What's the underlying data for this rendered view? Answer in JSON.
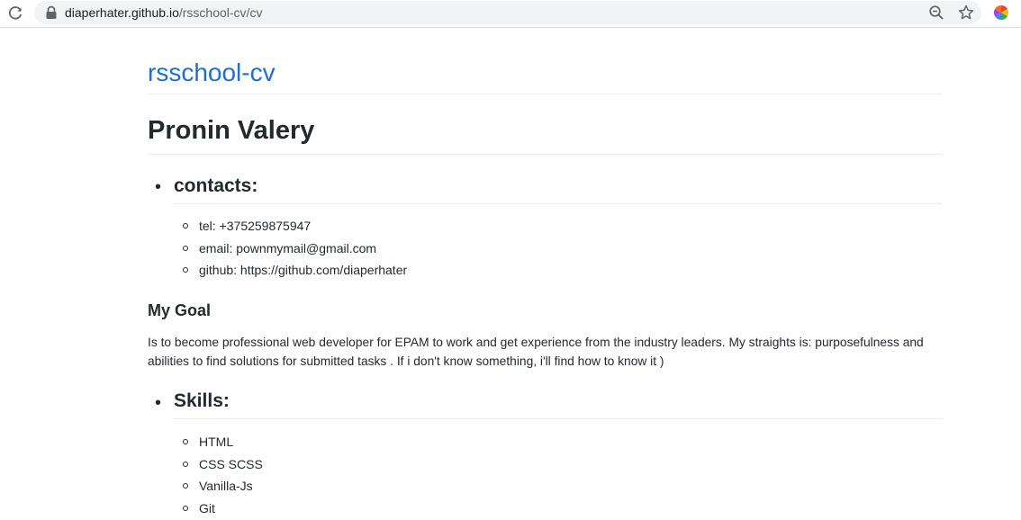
{
  "browser": {
    "url_host": "diaperhater.github.io",
    "url_path": "/rsschool-cv/cv",
    "icons": [
      "reload-icon",
      "lock-icon",
      "zoom-icon",
      "star-icon",
      "extension-icon"
    ]
  },
  "page": {
    "site_title": "rsschool-cv",
    "name": "Pronin Valery",
    "contacts": {
      "heading": "contacts:",
      "items": [
        "tel: +375259875947",
        "email: pownmymail@gmail.com",
        "github: https://github.com/diaperhater"
      ]
    },
    "goal": {
      "heading": "My Goal",
      "text": "Is to become professional web developer for EPAM to work and get experience from the industry leaders. My straights is: purposefulness and abilities to find solutions for submitted tasks . If i don't know something, i'll find how to know it )"
    },
    "skills": {
      "heading": "Skills:",
      "items": [
        "HTML",
        "CSS SCSS",
        "Vanilla-Js",
        "Git"
      ]
    }
  },
  "colors": {
    "link": "#1f6fd0",
    "text": "#24292e",
    "rule": "#eaecef",
    "omnibox": "#f1f3f4"
  }
}
